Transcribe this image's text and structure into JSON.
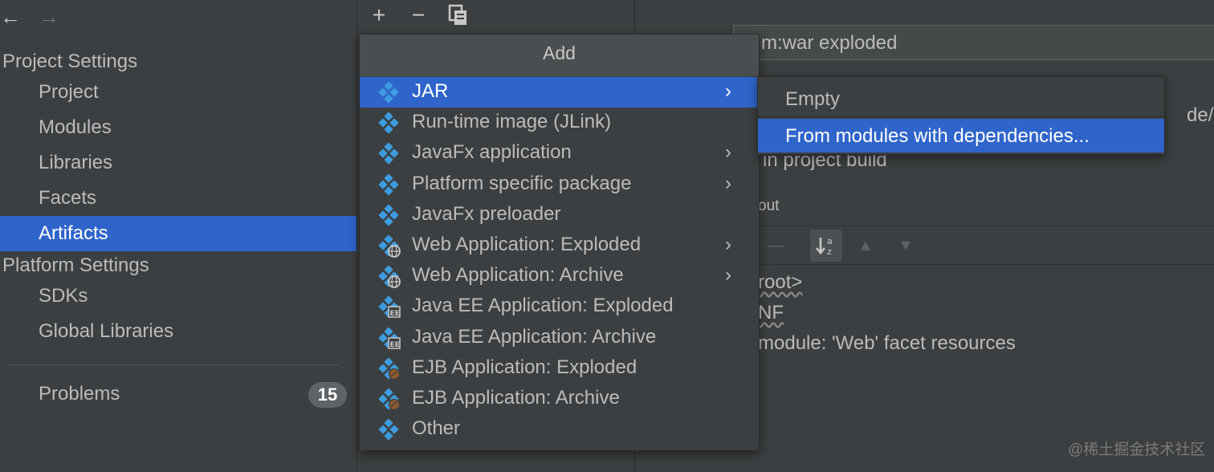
{
  "colors": {
    "background": "#3c3f41",
    "selection": "#2f65ca",
    "text": "#bbbbbb",
    "icon_accent": "#3d9cdf"
  },
  "toolbar": {
    "back_icon": "arrow-left-icon",
    "forward_icon": "arrow-right-icon",
    "add_icon": "plus-icon",
    "remove_icon": "minus-icon",
    "copy_icon": "copy-icon"
  },
  "sidebar": {
    "project_settings_title": "Project Settings",
    "project_items": [
      {
        "label": "Project"
      },
      {
        "label": "Modules"
      },
      {
        "label": "Libraries"
      },
      {
        "label": "Facets"
      },
      {
        "label": "Artifacts",
        "selected": true
      }
    ],
    "platform_settings_title": "Platform Settings",
    "platform_items": [
      {
        "label": "SDKs"
      },
      {
        "label": "Global Libraries"
      }
    ],
    "problems_label": "Problems",
    "problems_count": "15"
  },
  "add_menu": {
    "title": "Add",
    "items": [
      {
        "label": "JAR",
        "icon": "diamond-icon",
        "submenu": true,
        "selected": true
      },
      {
        "label": "Run-time image (JLink)",
        "icon": "diamond-icon",
        "submenu": false
      },
      {
        "label": "JavaFx application",
        "icon": "diamond-icon",
        "submenu": true
      },
      {
        "label": "Platform specific package",
        "icon": "diamond-icon",
        "submenu": true
      },
      {
        "label": "JavaFx preloader",
        "icon": "diamond-icon",
        "submenu": false
      },
      {
        "label": "Web Application: Exploded",
        "icon": "diamond-globe-icon",
        "submenu": true
      },
      {
        "label": "Web Application: Archive",
        "icon": "diamond-globe-icon",
        "submenu": true
      },
      {
        "label": "Java EE Application: Exploded",
        "icon": "diamond-ee-icon",
        "submenu": false
      },
      {
        "label": "Java EE Application: Archive",
        "icon": "diamond-ee-icon",
        "submenu": false
      },
      {
        "label": "EJB Application: Exploded",
        "icon": "diamond-bean-icon",
        "submenu": false
      },
      {
        "label": "EJB Application: Archive",
        "icon": "diamond-bean-icon",
        "submenu": false
      },
      {
        "label": "Other",
        "icon": "diamond-icon",
        "submenu": false
      }
    ]
  },
  "jar_submenu": {
    "items": [
      {
        "label": "Empty"
      },
      {
        "label": "From modules with dependencies...",
        "selected": true
      }
    ]
  },
  "artifact_panel": {
    "name_value": "m:war exploded",
    "path_partial": "de/M",
    "include_in_build": "in project build",
    "output_layout_label": "out",
    "tree_items": [
      "root>",
      "NF",
      "module: 'Web' facet resources"
    ]
  },
  "watermark": "@稀土掘金技术社区"
}
